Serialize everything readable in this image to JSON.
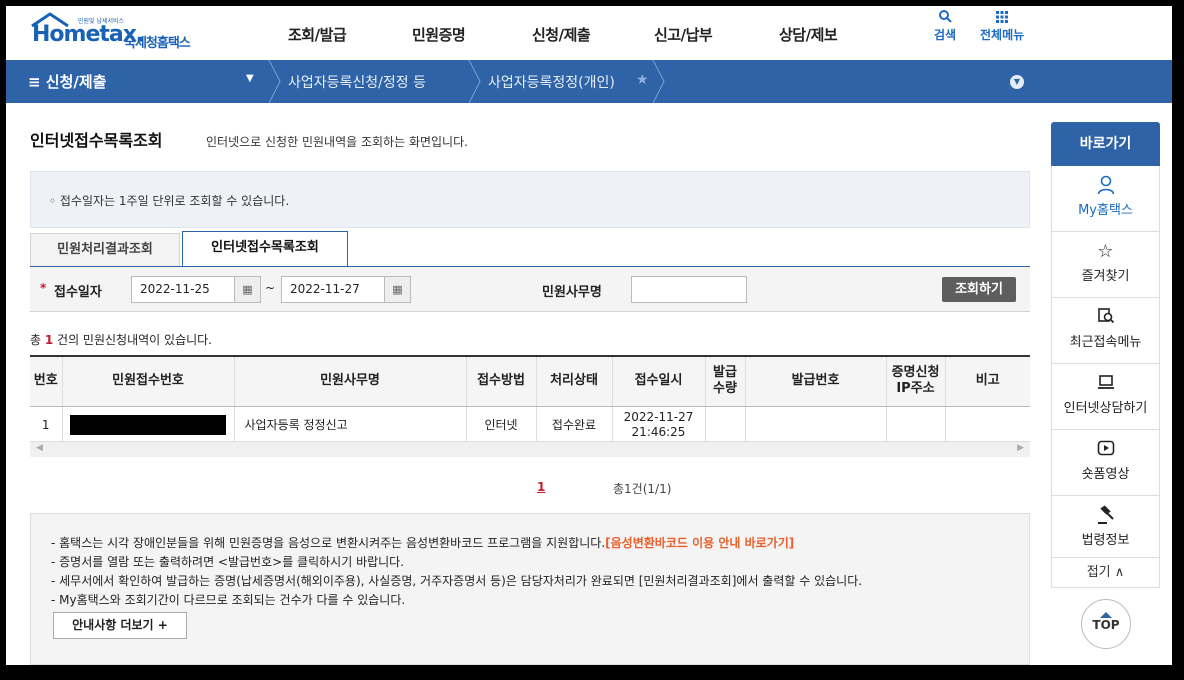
{
  "header": {
    "logo_small": "민원및 납세서비스",
    "logo_main": "Hometax.",
    "logo_sub": "국세청홈택스",
    "nav": [
      "조회/발급",
      "민원증명",
      "신청/제출",
      "신고/납부",
      "상담/제보"
    ],
    "search_label": "검색",
    "allmenu_label": "전체메뉴"
  },
  "navbar": {
    "menu_label": "≡  신청/제출",
    "crumbs": [
      "사업자등록신청/정정 등",
      "사업자등록정정(개인)"
    ]
  },
  "page": {
    "title": "인터넷접수목록조회",
    "description": "인터넷으로 신청한 민원내역을 조회하는 화면입니다.",
    "notice": "◦ 접수일자는 1주일 단위로 조회할 수 있습니다."
  },
  "tabs": [
    "민원처리결과조회",
    "인터넷접수목록조회"
  ],
  "search": {
    "required_mark": "*",
    "date_label": "접수일자",
    "date_from": "2022-11-25",
    "date_to": "2022-11-27",
    "tilde": "~",
    "name_label": "민원사무명",
    "name_value": "",
    "button": "조회하기"
  },
  "count": {
    "prefix": "총 ",
    "num": "1",
    "suffix": " 건의 민원신청내역이 있습니다."
  },
  "table": {
    "headers": [
      "번호",
      "민원접수번호",
      "민원사무명",
      "접수방법",
      "처리상태",
      "접수일시",
      "발급\n수량",
      "발급번호",
      "증명신청\nIP주소",
      "비고"
    ],
    "rows": [
      {
        "no": "1",
        "receipt_no": "",
        "name": "사업자등록 정정신고",
        "method": "인터넷",
        "status": "접수완료",
        "date": "2022-11-27",
        "time": "21:46:25",
        "qty": "",
        "issue_no": "",
        "ip": "",
        "note": ""
      }
    ]
  },
  "pager": {
    "current": "1",
    "total": "총1건(1/1)"
  },
  "info": {
    "lines": [
      "- 홈택스는 시각 장애인분들을 위해 민원증명을 음성으로 변환시켜주는 음성변환바코드 프로그램을 지원합니다.",
      "- 증명서를 열람 또는 출력하려면 <발급번호>를 클릭하시기 바랍니다.",
      "- 세무서에서 확인하여 발급하는 증명(납세증명서(해외이주용), 사실증명, 거주자증명서 등)은 담당자처리가 완료되면 [민원처리결과조회]에서 출력할 수 있습니다.",
      "- My홈택스와 조회기간이 다르므로 조회되는 건수가 다를 수 있습니다."
    ],
    "link": "[음성변환바코드 이용 안내 바로가기]",
    "more_button": "안내사항 더보기 +"
  },
  "quick": {
    "title": "바로가기",
    "items": [
      "My홈택스",
      "즐겨찾기",
      "최근접속메뉴",
      "인터넷상담하기",
      "숏폼영상",
      "법령정보"
    ],
    "fold": "접기 ∧",
    "top": "TOP"
  },
  "colors": {
    "brand": "#2e63a8",
    "accent": "#c8182b",
    "link": "#e8602c"
  }
}
